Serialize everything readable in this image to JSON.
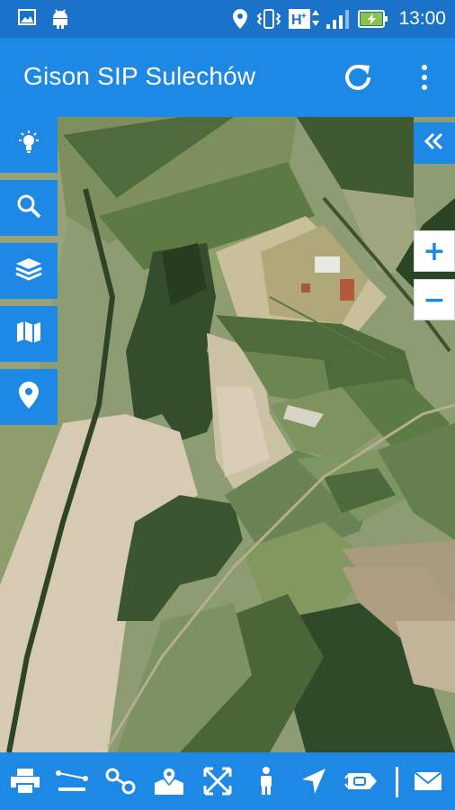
{
  "status_bar": {
    "time": "13:00",
    "icons": [
      "gallery-icon",
      "android-icon",
      "location-icon",
      "vibrate-icon",
      "hplus-network-icon",
      "signal-icon",
      "battery-charging-icon"
    ]
  },
  "app_bar": {
    "title": "Gison SIP Sulechów",
    "actions": [
      "refresh-icon",
      "more-vert-icon"
    ]
  },
  "map": {
    "left_tools": [
      "lightbulb-icon",
      "search-icon",
      "layers-icon",
      "map-icon",
      "location-pin-icon"
    ],
    "collapse_icon": "double-chevron-left-icon",
    "zoom_in_label": "+",
    "zoom_out_label": "−"
  },
  "bottom_toolbar": {
    "tools": [
      "print-icon",
      "measure-distance-icon",
      "link-icon",
      "map-marker-icon",
      "fullscreen-icon",
      "person-icon",
      "navigation-icon",
      "route-tag-icon",
      "email-icon"
    ]
  },
  "colors": {
    "primary": "#1e88e5",
    "status_bar": "#1a73c9",
    "zoom_bg": "#ffffff"
  }
}
